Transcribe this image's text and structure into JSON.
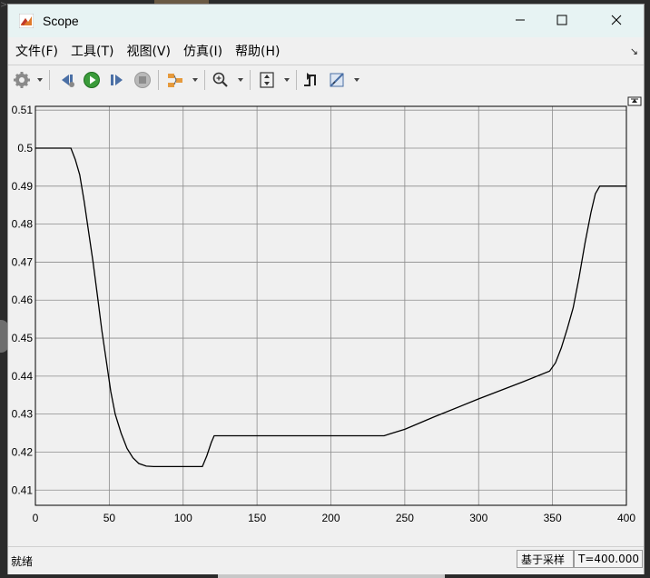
{
  "window": {
    "title": "Scope"
  },
  "menu": [
    {
      "label": "文件(F)"
    },
    {
      "label": "工具(T)"
    },
    {
      "label": "视图(V)"
    },
    {
      "label": "仿真(I)"
    },
    {
      "label": "帮助(H)"
    }
  ],
  "toolbar": {
    "icons": [
      "settings-icon",
      "step-back-icon",
      "run-icon",
      "step-forward-icon",
      "stop-icon",
      "signal-selector-icon",
      "zoom-icon",
      "autoscale-icon",
      "triggers-icon",
      "measurements-icon"
    ]
  },
  "status": {
    "left": "就绪",
    "sample": "基于采样",
    "time": "T=400.000"
  },
  "chart_data": {
    "type": "line",
    "title": "",
    "xlabel": "",
    "ylabel": "",
    "xlim": [
      0,
      400
    ],
    "ylim": [
      0.406,
      0.511
    ],
    "xticks": [
      0,
      50,
      100,
      150,
      200,
      250,
      300,
      350,
      400
    ],
    "yticks": [
      0.41,
      0.42,
      0.43,
      0.44,
      0.45,
      0.46,
      0.47,
      0.48,
      0.49,
      0.5,
      0.51
    ],
    "ytick_labels": [
      "0.41",
      "0.42",
      "0.43",
      "0.44",
      "0.45",
      "0.46",
      "0.47",
      "0.48",
      "0.49",
      "0.5",
      "0.51"
    ],
    "grid": true,
    "series": [
      {
        "color": "#000000",
        "x": [
          0,
          24,
          27,
          30,
          33,
          36,
          39,
          42,
          45,
          48,
          51,
          54,
          58,
          62,
          66,
          70,
          75,
          80,
          90,
          100,
          110,
          113,
          116,
          119,
          121,
          130,
          150,
          200,
          230,
          236,
          240,
          250,
          270,
          300,
          330,
          348,
          352,
          356,
          360,
          364,
          368,
          372,
          376,
          379,
          382,
          400
        ],
        "y": [
          0.5,
          0.5,
          0.497,
          0.493,
          0.486,
          0.478,
          0.47,
          0.461,
          0.452,
          0.444,
          0.436,
          0.43,
          0.425,
          0.421,
          0.4185,
          0.417,
          0.4163,
          0.4162,
          0.4162,
          0.4162,
          0.4162,
          0.4162,
          0.419,
          0.4225,
          0.4243,
          0.4243,
          0.4243,
          0.4243,
          0.4243,
          0.4243,
          0.4248,
          0.426,
          0.4293,
          0.434,
          0.4385,
          0.4413,
          0.4435,
          0.4475,
          0.4525,
          0.458,
          0.466,
          0.475,
          0.483,
          0.488,
          0.49,
          0.49
        ]
      }
    ]
  }
}
